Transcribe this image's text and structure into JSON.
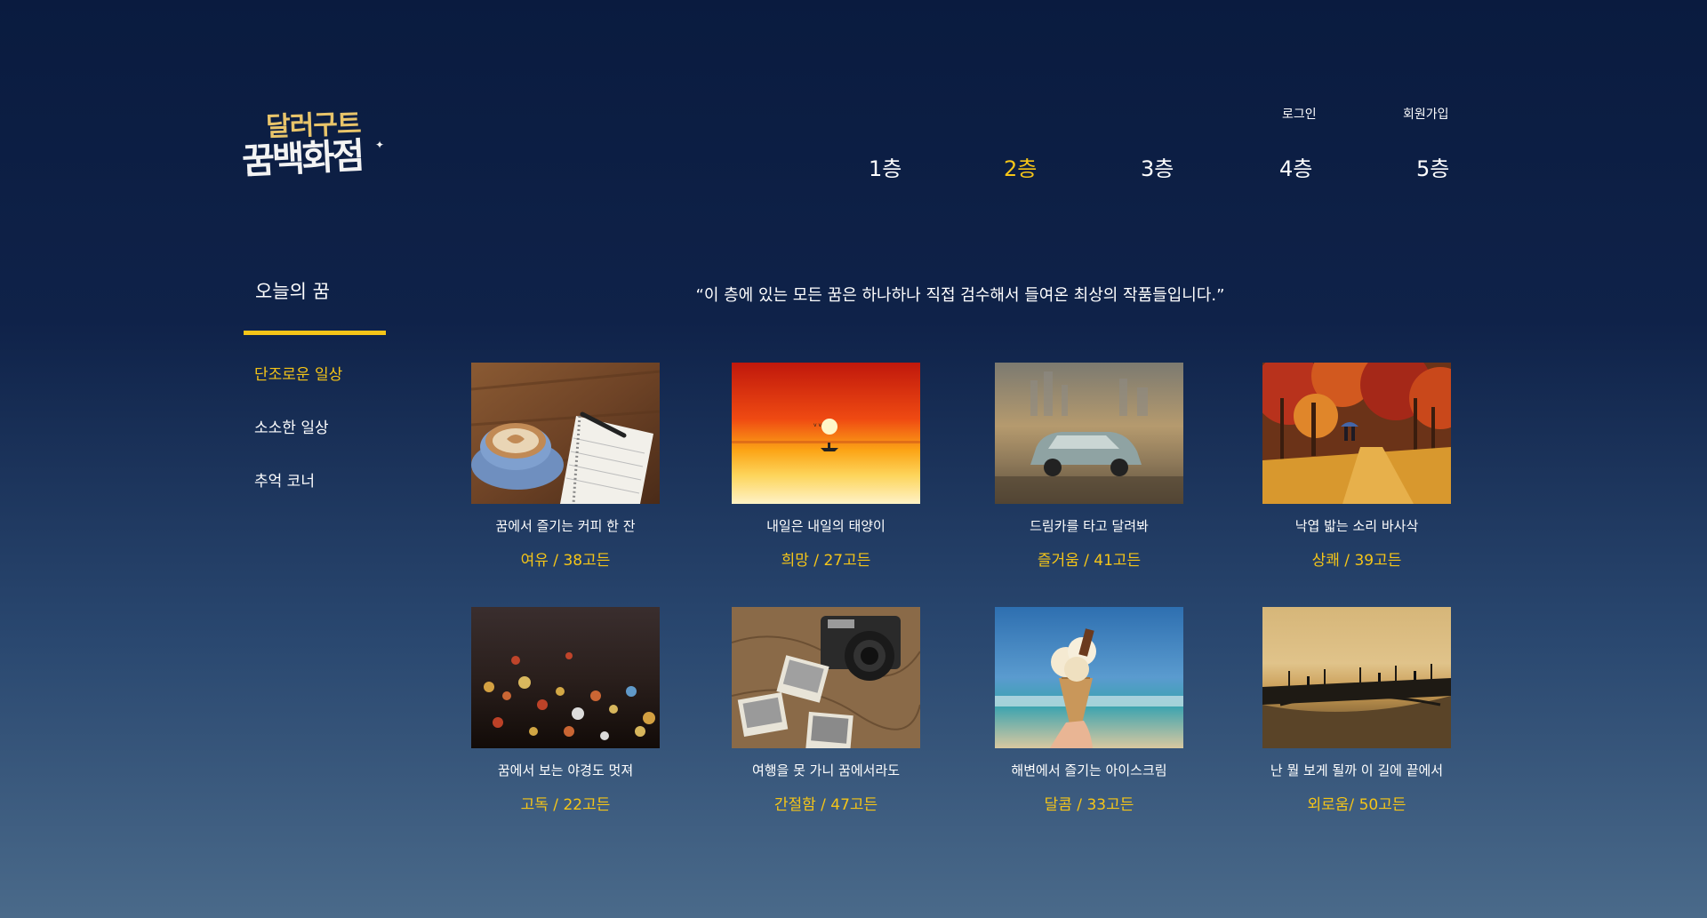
{
  "logo": {
    "line1": "달러구트",
    "line2": "꿈백화점"
  },
  "header": {
    "login_label": "로그인",
    "signup_label": "회원가입",
    "floors": [
      "1층",
      "2층",
      "3층",
      "4층",
      "5층"
    ],
    "active_floor": "2층"
  },
  "sidebar": {
    "title": "오늘의 꿈",
    "items": [
      {
        "label": "단조로운 일상",
        "active": true
      },
      {
        "label": "소소한 일상",
        "active": false
      },
      {
        "label": "추억 코너",
        "active": false
      }
    ]
  },
  "main": {
    "quote": "“이 층에 있는 모든 꿈은 하나하나 직접 검수해서 들여온 최상의 작품들입니다.”"
  },
  "products": [
    {
      "name": "꿈에서 즐기는 커피 한 잔",
      "price": "여유 / 38고든",
      "image": "coffee-notebook"
    },
    {
      "name": "내일은 내일의 태양이",
      "price": "희망 / 27고든",
      "image": "red-sunset-sea"
    },
    {
      "name": "드림카를 타고 달려봐",
      "price": "즐거움 / 41고든",
      "image": "toy-car-city"
    },
    {
      "name": "낙엽 밟는 소리 바사삭",
      "price": "상쾌 / 39고든",
      "image": "autumn-path"
    },
    {
      "name": "꿈에서 보는 야경도 멋져",
      "price": "고독 / 22고든",
      "image": "city-night-bokeh"
    },
    {
      "name": "여행을 못 가니 꿈에서라도",
      "price": "간절함 / 47고든",
      "image": "camera-map-photos"
    },
    {
      "name": "해변에서 즐기는 아이스크림",
      "price": "달콤 / 33고든",
      "image": "icecream-beach"
    },
    {
      "name": "난 뭘 보게 될까 이 길에 끝에서",
      "price": "외로움/ 50고든",
      "image": "bridge-sunset"
    }
  ],
  "colors": {
    "accent": "#f5c518",
    "background_top": "#0a1b3f",
    "background_bottom": "#4a6a8a"
  }
}
